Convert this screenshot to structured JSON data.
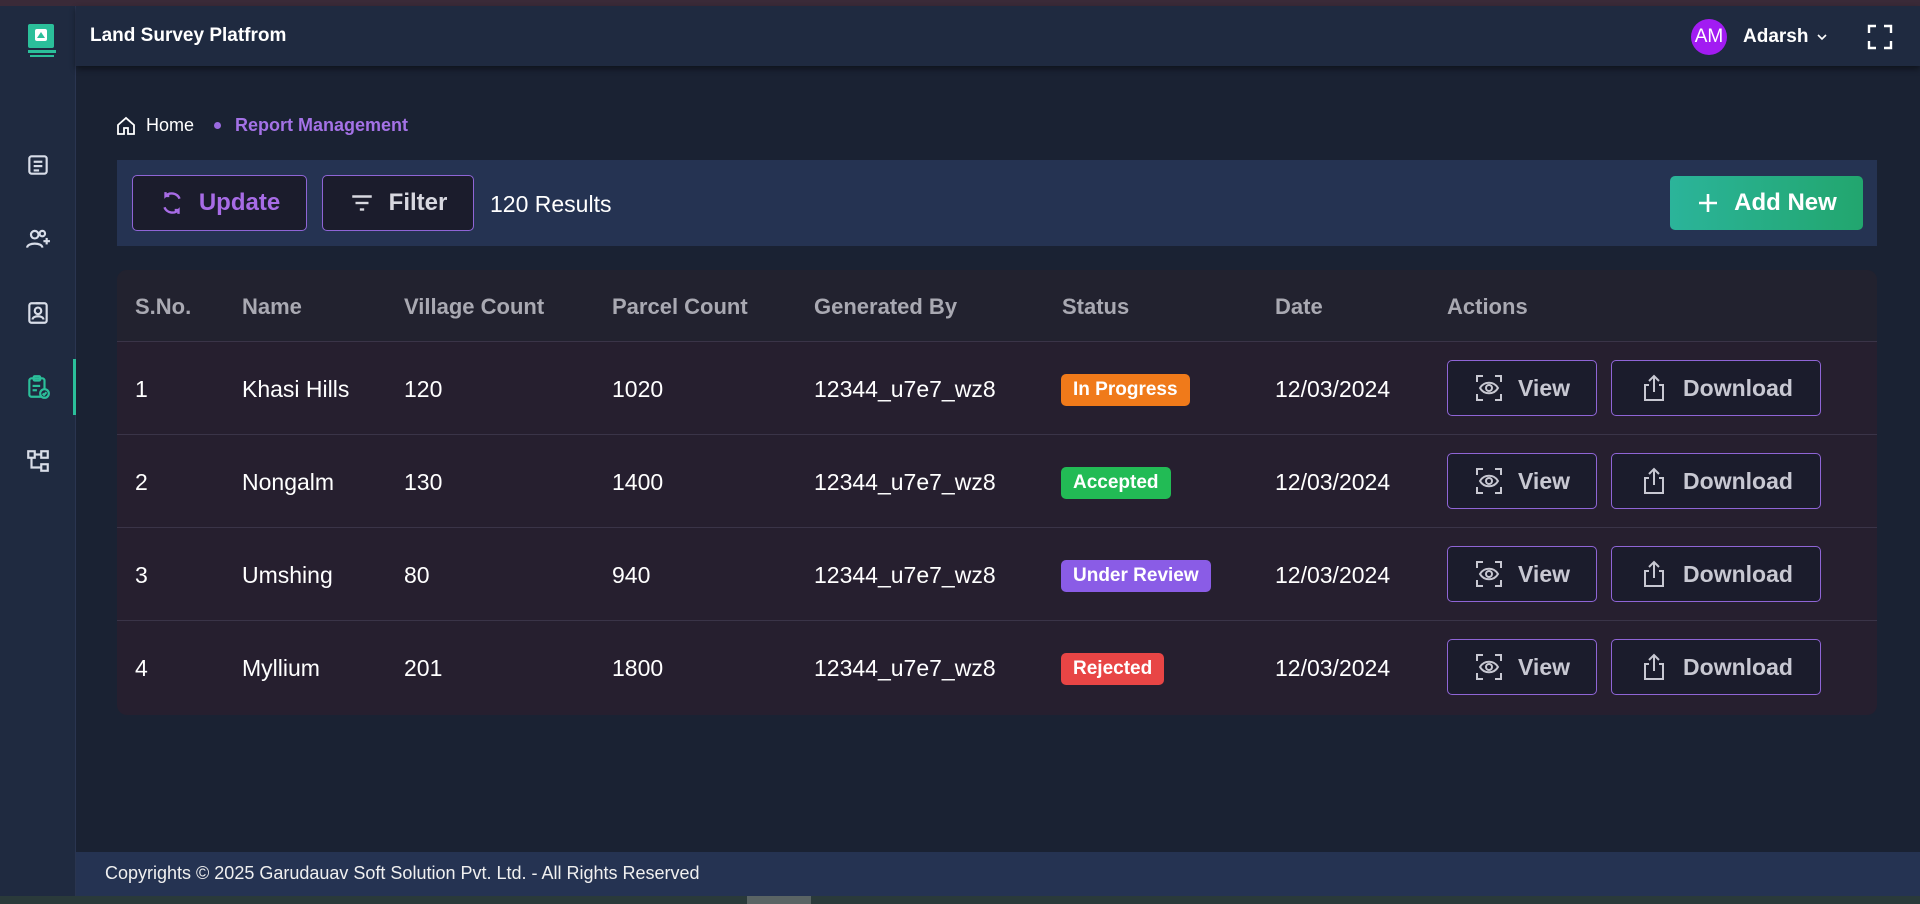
{
  "header": {
    "app_title": "Land Survey Platfrom",
    "avatar_initials": "AM",
    "username": "Adarsh"
  },
  "sidebar": {
    "items": [
      {
        "icon": "document-list-icon"
      },
      {
        "icon": "add-user-icon"
      },
      {
        "icon": "id-badge-icon"
      },
      {
        "icon": "clipboard-check-icon",
        "active": true
      },
      {
        "icon": "hierarchy-icon"
      }
    ]
  },
  "breadcrumb": {
    "home": "Home",
    "current": "Report Management"
  },
  "toolbar": {
    "update_label": "Update",
    "filter_label": "Filter",
    "results_text": "120 Results",
    "add_new_label": "Add New"
  },
  "table": {
    "columns": [
      "S.No.",
      "Name",
      "Village Count",
      "Parcel Count",
      "Generated By",
      "Status",
      "Date",
      "Actions"
    ],
    "rows": [
      {
        "sno": "1",
        "name": "Khasi Hills",
        "village_count": "120",
        "parcel_count": "1020",
        "generated_by": "12344_u7e7_wz8",
        "status": "In Progress",
        "status_color": "#f07a1a",
        "date": "12/03/2024"
      },
      {
        "sno": "2",
        "name": "Nongalm",
        "village_count": "130",
        "parcel_count": "1400",
        "generated_by": "12344_u7e7_wz8",
        "status": "Accepted",
        "status_color": "#22bb55",
        "date": "12/03/2024"
      },
      {
        "sno": "3",
        "name": "Umshing",
        "village_count": "80",
        "parcel_count": "940",
        "generated_by": "12344_u7e7_wz8",
        "status": "Under Review",
        "status_color": "#8a5ce6",
        "date": "12/03/2024"
      },
      {
        "sno": "4",
        "name": "Myllium",
        "village_count": "201",
        "parcel_count": "1800",
        "generated_by": "12344_u7e7_wz8",
        "status": "Rejected",
        "status_color": "#e84545",
        "date": "12/03/2024"
      }
    ],
    "view_label": "View",
    "download_label": "Download"
  },
  "footer": {
    "text": "Copyrights © 2025 Garudauav Soft Solution Pvt. Ltd. - All Rights Reserved"
  },
  "colors": {
    "accent_purple": "#8f65d6",
    "accent_green": "#2bb49a",
    "background": "#1a2233"
  }
}
